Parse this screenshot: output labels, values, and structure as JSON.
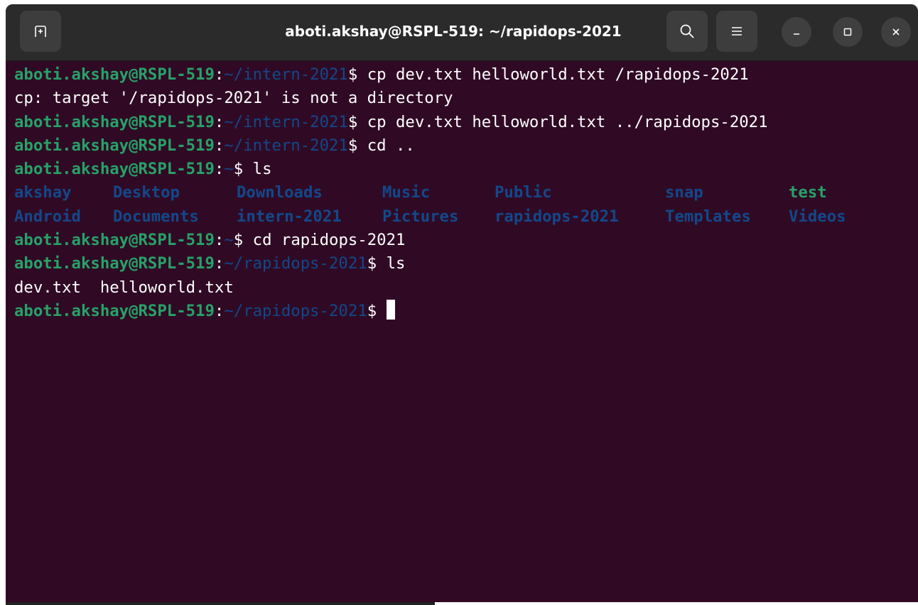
{
  "window": {
    "title": "aboti.akshay@RSPL-519: ~/rapidops-2021"
  },
  "icons": {
    "new_tab": "new-tab-icon",
    "search": "search-icon",
    "menu": "hamburger-menu-icon",
    "minimize": "minimize-icon",
    "maximize": "maximize-icon",
    "close": "close-icon"
  },
  "colors": {
    "terminal_bg": "#300a24",
    "user_host": "#26a269",
    "path": "#12488b",
    "text": "#ffffff"
  },
  "terminal": {
    "lines": [
      {
        "user": "aboti.akshay@RSPL-519",
        "sep": ":",
        "path": "~/intern-2021",
        "prompt": "$ ",
        "cmd": "cp dev.txt helloworld.txt /rapidops-2021"
      },
      {
        "output": "cp: target '/rapidops-2021' is not a directory"
      },
      {
        "user": "aboti.akshay@RSPL-519",
        "sep": ":",
        "path": "~/intern-2021",
        "prompt": "$ ",
        "cmd": "cp dev.txt helloworld.txt ../rapidops-2021"
      },
      {
        "user": "aboti.akshay@RSPL-519",
        "sep": ":",
        "path": "~/intern-2021",
        "prompt": "$ ",
        "cmd": "cd .."
      },
      {
        "user": "aboti.akshay@RSPL-519",
        "sep": ":",
        "path": "~",
        "prompt": "$ ",
        "cmd": "ls"
      }
    ],
    "ls_home": [
      [
        "akshay",
        "Desktop",
        "Downloads",
        "Music",
        "Public",
        "snap",
        "test"
      ],
      [
        "Android",
        "Documents",
        "intern-2021",
        "Pictures",
        "rapidops-2021",
        "Templates",
        "Videos"
      ]
    ],
    "lines2": [
      {
        "user": "aboti.akshay@RSPL-519",
        "sep": ":",
        "path": "~",
        "prompt": "$ ",
        "cmd": "cd rapidops-2021"
      },
      {
        "user": "aboti.akshay@RSPL-519",
        "sep": ":",
        "path": "~/rapidops-2021",
        "prompt": "$ ",
        "cmd": "ls"
      },
      {
        "output": "dev.txt  helloworld.txt"
      },
      {
        "user": "aboti.akshay@RSPL-519",
        "sep": ":",
        "path": "~/rapidops-2021",
        "prompt": "$ ",
        "cmd": ""
      }
    ]
  }
}
